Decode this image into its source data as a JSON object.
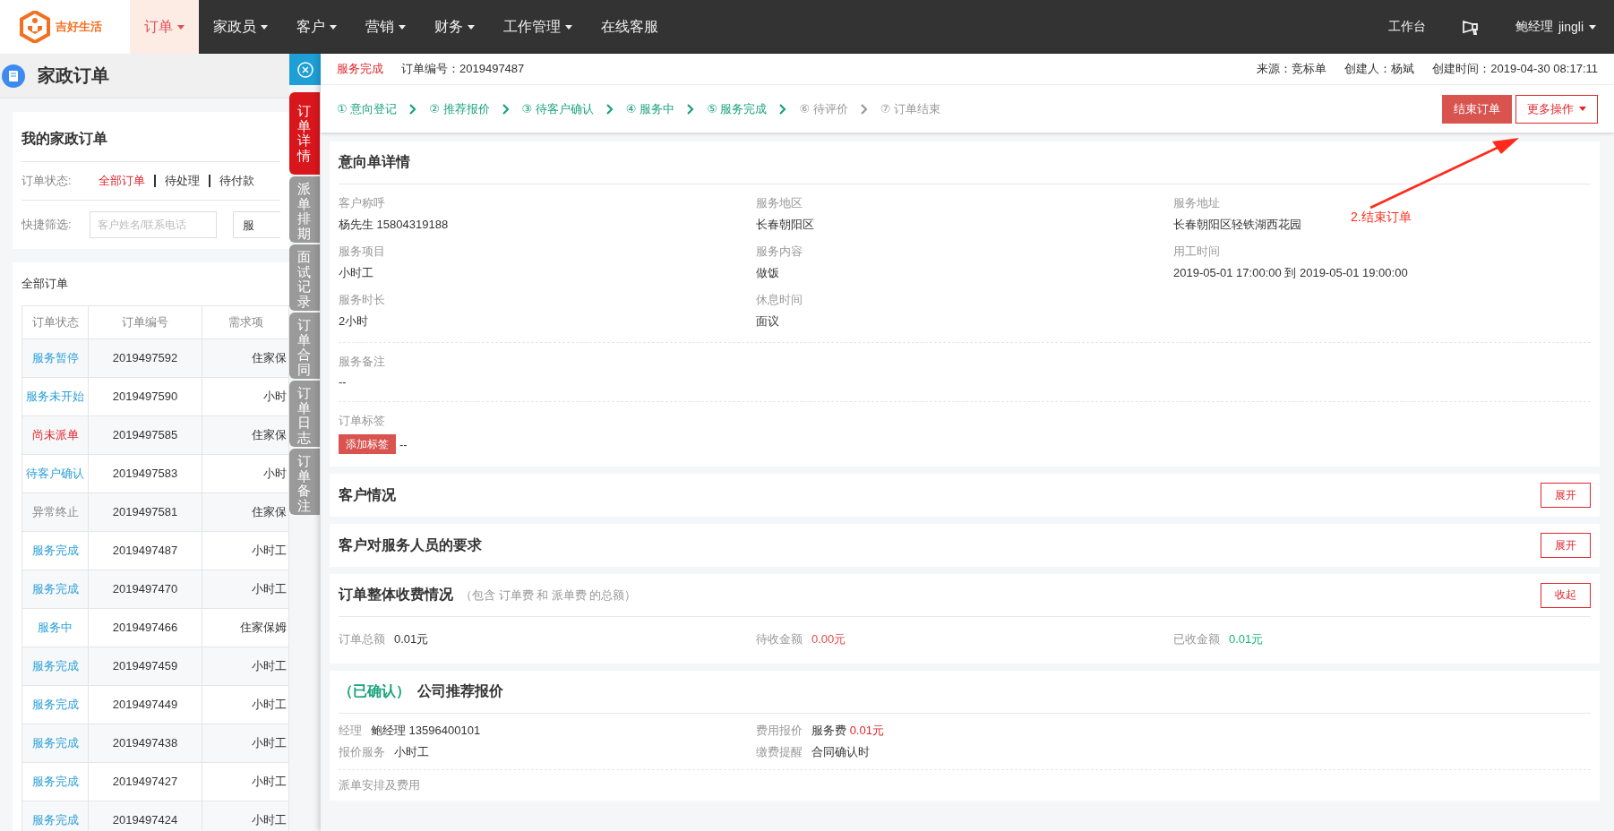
{
  "nav": {
    "logo": "吉好生活",
    "items": [
      {
        "label": "订单",
        "caret": true,
        "selected": true
      },
      {
        "label": "家政员",
        "caret": true,
        "selected": false
      },
      {
        "label": "客户",
        "caret": true,
        "selected": false
      },
      {
        "label": "营销",
        "caret": true,
        "selected": false
      },
      {
        "label": "财务",
        "caret": true,
        "selected": false
      },
      {
        "label": "工作管理",
        "caret": true,
        "selected": false
      },
      {
        "label": "在线客服",
        "caret": false,
        "selected": false
      }
    ],
    "workbench": "工作台",
    "user": "鲍经理",
    "username": "jingli"
  },
  "left": {
    "title": "家政订单",
    "card_title": "我的家政订单",
    "status_label": "订单状态:",
    "status_filters": [
      {
        "label": "全部订单",
        "selected": true
      },
      {
        "label": "待处理",
        "selected": false
      },
      {
        "label": "待付款",
        "selected": false
      }
    ],
    "quick_label": "快捷筛选:",
    "search": {
      "placeholder": "客户姓名/联系电话"
    },
    "select": "服",
    "table": {
      "title": "全部订单",
      "columns": [
        "订单状态",
        "订单编号",
        "需求项"
      ],
      "rows": [
        {
          "status": "服务暂停",
          "color": "#2a9fd6",
          "number": "2019497592",
          "item": "住家保"
        },
        {
          "status": "服务未开始",
          "color": "#2a9fd6",
          "number": "2019497590",
          "item": "小时"
        },
        {
          "status": "尚未派单",
          "color": "#e0252b",
          "number": "2019497585",
          "item": "住家保"
        },
        {
          "status": "待客户确认",
          "color": "#2a9fd6",
          "number": "2019497583",
          "item": "小时"
        },
        {
          "status": "异常终止",
          "color": "#888888",
          "number": "2019497581",
          "item": "住家保"
        },
        {
          "status": "服务完成",
          "color": "#2a9fd6",
          "number": "2019497487",
          "item": "小时工"
        },
        {
          "status": "服务完成",
          "color": "#2a9fd6",
          "number": "2019497470",
          "item": "小时工"
        },
        {
          "status": "服务中",
          "color": "#2a9fd6",
          "number": "2019497466",
          "item": "住家保姆"
        },
        {
          "status": "服务完成",
          "color": "#2a9fd6",
          "number": "2019497459",
          "item": "小时工"
        },
        {
          "status": "服务完成",
          "color": "#2a9fd6",
          "number": "2019497449",
          "item": "小时工"
        },
        {
          "status": "服务完成",
          "color": "#2a9fd6",
          "number": "2019497438",
          "item": "小时工"
        },
        {
          "status": "服务完成",
          "color": "#2a9fd6",
          "number": "2019497427",
          "item": "小时工"
        },
        {
          "status": "服务完成",
          "color": "#2a9fd6",
          "number": "2019497424",
          "item": "小时工"
        }
      ]
    }
  },
  "side_tabs": [
    {
      "label": "订单详情",
      "selected": true
    },
    {
      "label": "派单排期",
      "selected": false
    },
    {
      "label": "面试记录",
      "selected": false
    },
    {
      "label": "订单合同",
      "selected": false
    },
    {
      "label": "订单日志",
      "selected": false
    },
    {
      "label": "订单备注",
      "selected": false
    }
  ],
  "order": {
    "status": "服务完成",
    "number": "订单编号：2019497487",
    "source": "来源：竞标单",
    "creator": "创建人：杨斌",
    "created": "创建时间：2019-04-30 08:17:11",
    "steps": [
      {
        "num": "①",
        "label": "意向登记",
        "done": true
      },
      {
        "num": "②",
        "label": "推荐报价",
        "done": true
      },
      {
        "num": "③",
        "label": "待客户确认",
        "done": true
      },
      {
        "num": "④",
        "label": "服务中",
        "done": true
      },
      {
        "num": "⑤",
        "label": "服务完成",
        "done": true
      },
      {
        "num": "⑥",
        "label": "待评价",
        "done": false
      },
      {
        "num": "⑦",
        "label": "订单结束",
        "done": false
      }
    ],
    "actions": [
      {
        "label": "结束订单",
        "kind": "primary"
      },
      {
        "label": "更多操作",
        "kind": "dropdown"
      }
    ]
  },
  "annotation": "2.结束订单",
  "intent": {
    "title": "意向单详情",
    "fields": [
      {
        "label": "客户称呼",
        "value": "杨先生 15804319188"
      },
      {
        "label": "服务地区",
        "value": "长春朝阳区"
      },
      {
        "label": "服务地址",
        "value": "长春朝阳区轻铁湖西花园"
      },
      {
        "label": "服务项目",
        "value": "小时工"
      },
      {
        "label": "服务内容",
        "value": "做饭"
      },
      {
        "label": "用工时间",
        "value": "2019-05-01 17:00:00 到 2019-05-01 19:00:00"
      },
      {
        "label": "服务时长",
        "value": "2小时"
      },
      {
        "label": "休息时间",
        "value": "面议"
      }
    ],
    "remark_label": "服务备注",
    "remark": "--",
    "tags_label": "订单标签",
    "tag_button": "添加标签",
    "tags": "--"
  },
  "sections": [
    {
      "title": "客户情况",
      "button": "展开",
      "expanded": false
    },
    {
      "title": "客户对服务人员的要求",
      "button": "展开",
      "expanded": false
    },
    {
      "title": "订单整体收费情况",
      "note": "（包含 订单费 和 派单费 的总额）",
      "button": "收起",
      "expanded": true,
      "amounts": [
        {
          "label": "订单总额",
          "value": "0.01元",
          "color": "#333333"
        },
        {
          "label": "待收金额",
          "value": "0.00元",
          "color": "#e84a4a"
        },
        {
          "label": "已收金额",
          "value": "0.01元",
          "color": "#19b27b"
        }
      ]
    }
  ],
  "quote": {
    "status": "（已确认）",
    "title": "公司推荐报价",
    "items": [
      {
        "label": "经理",
        "value": "鲍经理 13596400101"
      },
      {
        "label": "费用报价",
        "value": "服务费",
        "price": "0.01元"
      },
      {
        "label": "报价服务",
        "value": "小时工"
      },
      {
        "label": "缴费提醒",
        "value": "合同确认时"
      }
    ],
    "sub": "派单安排及费用"
  }
}
